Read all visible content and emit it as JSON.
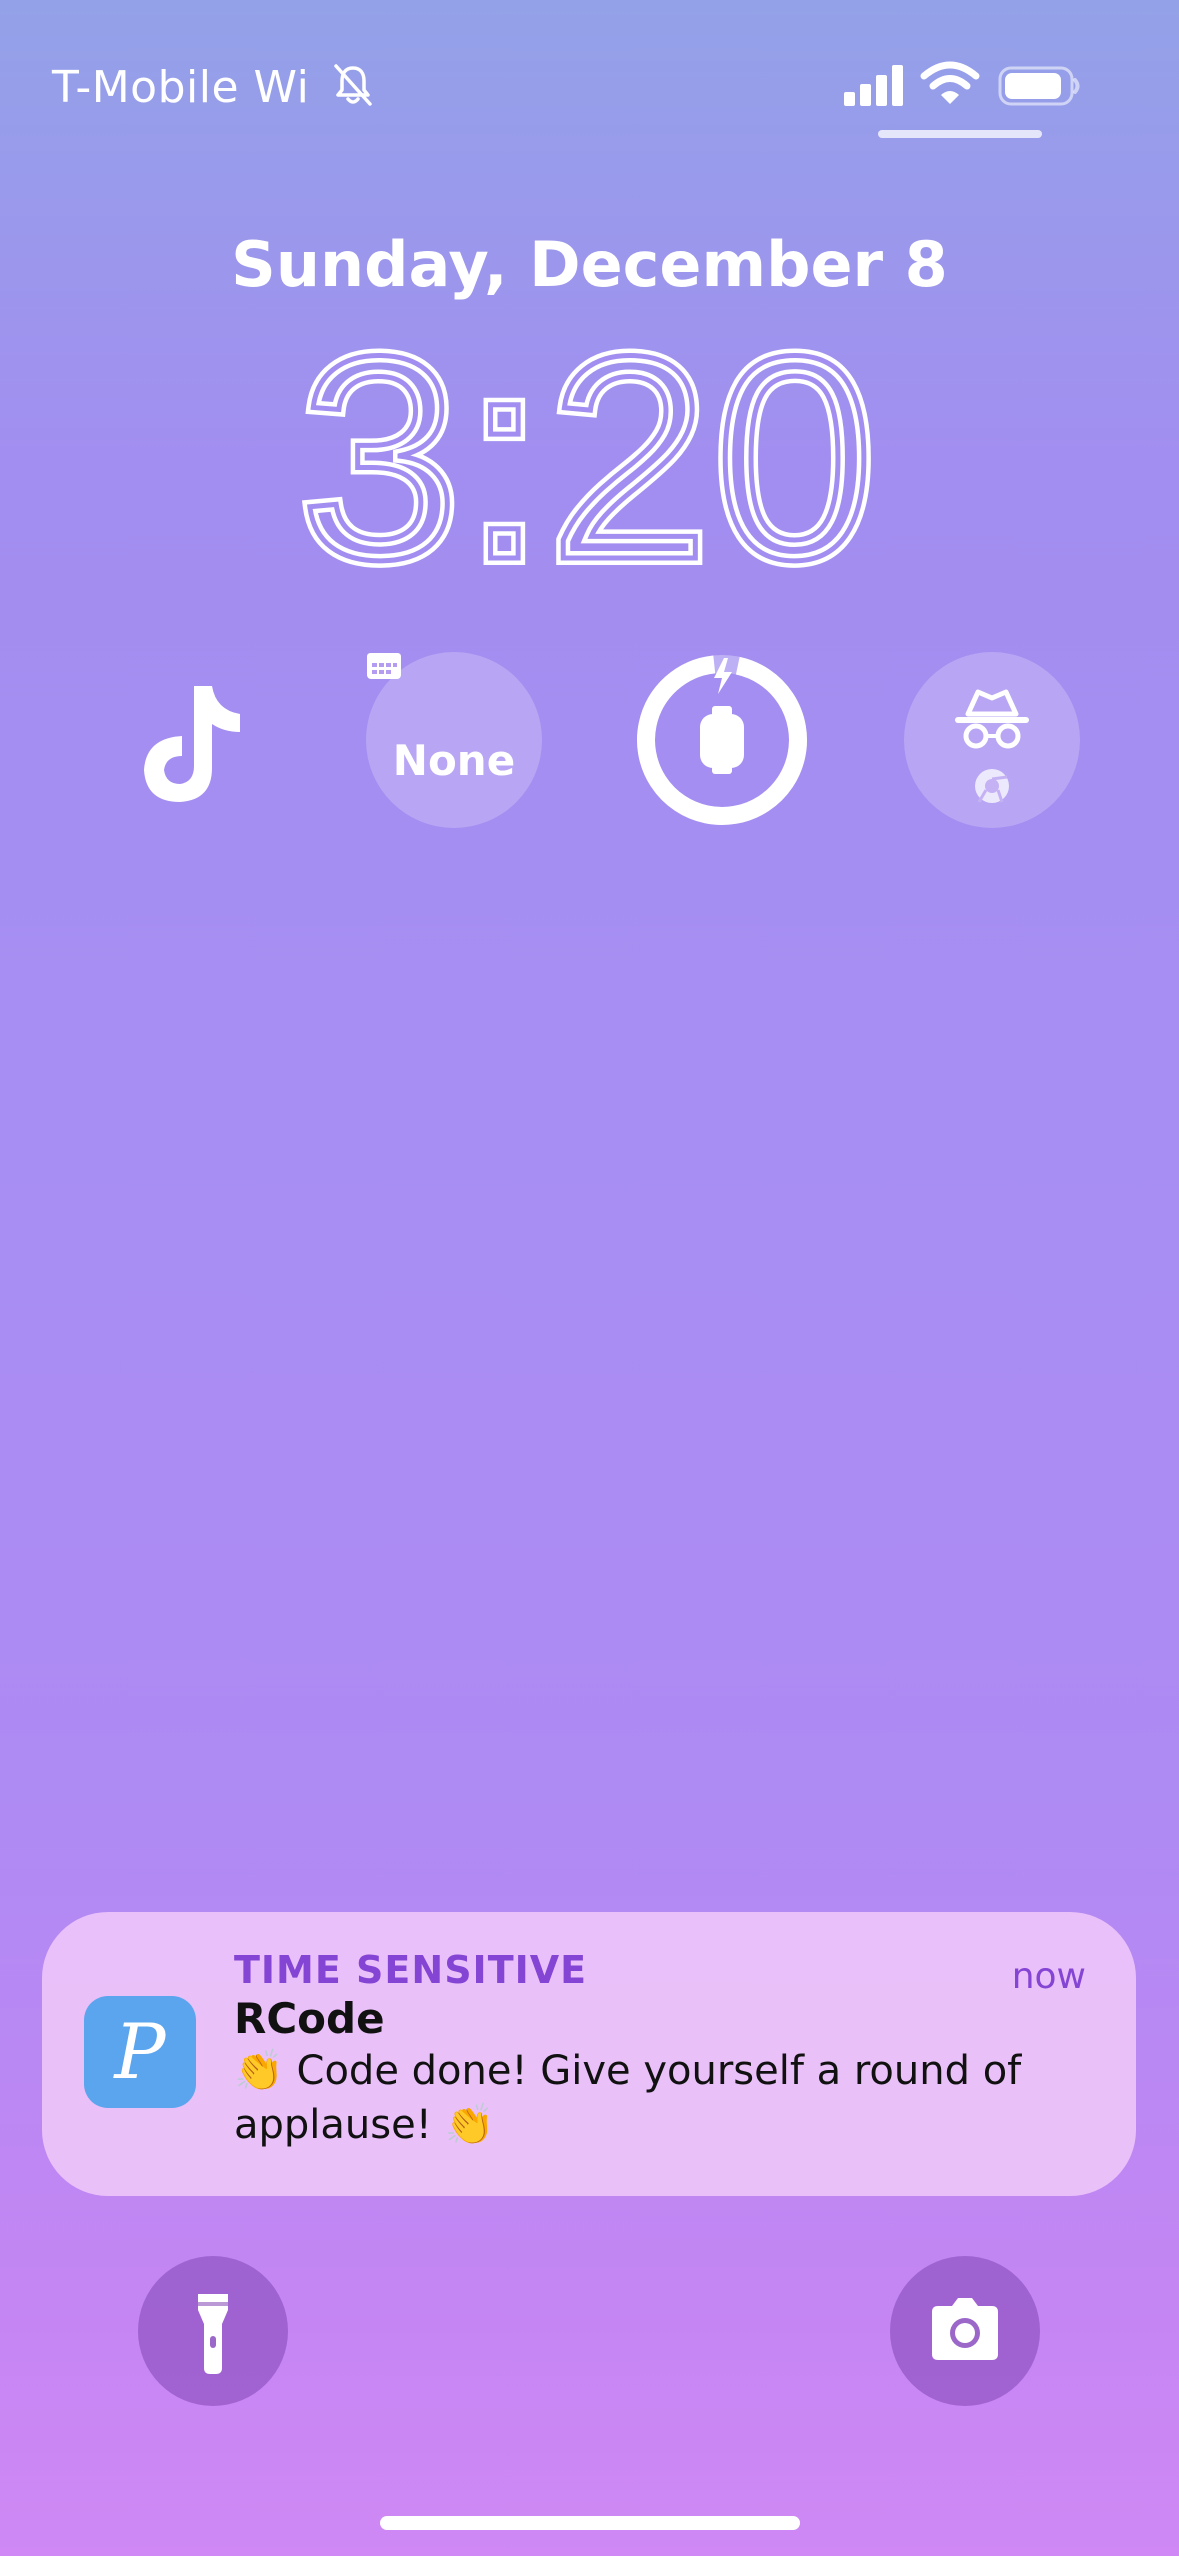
{
  "status_bar": {
    "carrier": "T-Mobile Wi",
    "icons": [
      "bell-slash-icon",
      "cellular-signal-icon",
      "wifi-icon",
      "battery-icon"
    ]
  },
  "lock_screen": {
    "date": "Sunday, December 8",
    "time": "3:20"
  },
  "widgets": [
    {
      "icon": "tiktok-icon",
      "label": ""
    },
    {
      "icon": "calendar-icon",
      "label": "None"
    },
    {
      "icon": "watch-battery-icon",
      "level": 0.95
    },
    {
      "icon": "incognito-icon",
      "secondary_icon": "chrome-icon"
    }
  ],
  "notification": {
    "category": "TIME SENSITIVE",
    "time": "now",
    "app_name": "RCode",
    "app_icon_glyph": "P",
    "body": "👏 Code done! Give yourself a round of applause! 👏",
    "app_icon_color": "#5aa5ee",
    "accent_color": "#8444d4"
  },
  "quick_actions": {
    "left_icon": "flashlight-icon",
    "right_icon": "camera-icon"
  }
}
